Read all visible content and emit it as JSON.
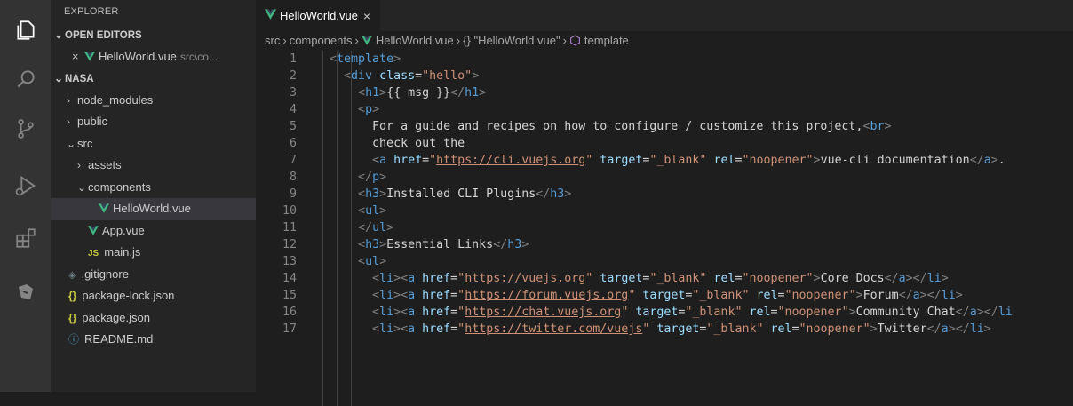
{
  "activity_bar": {
    "icons": [
      "explorer-icon",
      "search-icon",
      "source-control-icon",
      "run-debug-icon",
      "extensions-icon",
      "remote-explorer-icon"
    ]
  },
  "sidebar": {
    "title": "EXPLORER",
    "open_editors": {
      "label": "OPEN EDITORS",
      "items": [
        {
          "name": "HelloWorld.vue",
          "path": "src\\co..."
        }
      ]
    },
    "project": {
      "label": "NASA",
      "tree": [
        {
          "label": "node_modules",
          "kind": "folder",
          "state": "collapsed",
          "depth": 1
        },
        {
          "label": "public",
          "kind": "folder",
          "state": "collapsed",
          "depth": 1
        },
        {
          "label": "src",
          "kind": "folder",
          "state": "expanded",
          "depth": 1
        },
        {
          "label": "assets",
          "kind": "folder",
          "state": "collapsed",
          "depth": 2
        },
        {
          "label": "components",
          "kind": "folder",
          "state": "expanded",
          "depth": 2
        },
        {
          "label": "HelloWorld.vue",
          "kind": "vue",
          "depth": 3,
          "selected": true
        },
        {
          "label": "App.vue",
          "kind": "vue",
          "depth": 2
        },
        {
          "label": "main.js",
          "kind": "js",
          "depth": 2
        },
        {
          "label": ".gitignore",
          "kind": "git",
          "depth": 1
        },
        {
          "label": "package-lock.json",
          "kind": "json",
          "depth": 1
        },
        {
          "label": "package.json",
          "kind": "json",
          "depth": 1
        },
        {
          "label": "README.md",
          "kind": "info",
          "depth": 1
        }
      ]
    }
  },
  "editor": {
    "tab": {
      "label": "HelloWorld.vue",
      "close": "×"
    },
    "breadcrumb": {
      "parts": [
        "src",
        "components",
        "HelloWorld.vue",
        "\"HelloWorld.vue\"",
        "template"
      ],
      "obj_glyph": "{}"
    },
    "lines": [
      {
        "n": "1",
        "indent": 2,
        "tokens": [
          [
            "br",
            "<"
          ],
          [
            "tag",
            "template"
          ],
          [
            "br",
            ">"
          ]
        ]
      },
      {
        "n": "2",
        "indent": 4,
        "tokens": [
          [
            "br",
            "<"
          ],
          [
            "tag",
            "div"
          ],
          [
            "text",
            " "
          ],
          [
            "attr",
            "class"
          ],
          [
            "text",
            "="
          ],
          [
            "str",
            "\"hello\""
          ],
          [
            "br",
            ">"
          ]
        ]
      },
      {
        "n": "3",
        "indent": 6,
        "tokens": [
          [
            "br",
            "<"
          ],
          [
            "tag",
            "h1"
          ],
          [
            "br",
            ">"
          ],
          [
            "text",
            "{{ msg }}"
          ],
          [
            "br",
            "</"
          ],
          [
            "tag",
            "h1"
          ],
          [
            "br",
            ">"
          ]
        ]
      },
      {
        "n": "4",
        "indent": 6,
        "tokens": [
          [
            "br",
            "<"
          ],
          [
            "tag",
            "p"
          ],
          [
            "br",
            ">"
          ]
        ]
      },
      {
        "n": "5",
        "indent": 8,
        "tokens": [
          [
            "text",
            "For a guide and recipes on how to configure / customize this project,"
          ],
          [
            "br",
            "<"
          ],
          [
            "tag",
            "br"
          ],
          [
            "br",
            ">"
          ]
        ]
      },
      {
        "n": "6",
        "indent": 8,
        "tokens": [
          [
            "text",
            "check out the"
          ]
        ]
      },
      {
        "n": "7",
        "indent": 8,
        "tokens": [
          [
            "br",
            "<"
          ],
          [
            "tag",
            "a"
          ],
          [
            "text",
            " "
          ],
          [
            "attr",
            "href"
          ],
          [
            "text",
            "="
          ],
          [
            "str",
            "\""
          ],
          [
            "url",
            "https://cli.vuejs.org"
          ],
          [
            "str",
            "\""
          ],
          [
            "text",
            " "
          ],
          [
            "attr",
            "target"
          ],
          [
            "text",
            "="
          ],
          [
            "str",
            "\"_blank\""
          ],
          [
            "text",
            " "
          ],
          [
            "attr",
            "rel"
          ],
          [
            "text",
            "="
          ],
          [
            "str",
            "\"noopener\""
          ],
          [
            "br",
            ">"
          ],
          [
            "text",
            "vue-cli documentation"
          ],
          [
            "br",
            "</"
          ],
          [
            "tag",
            "a"
          ],
          [
            "br",
            ">"
          ],
          [
            "text",
            "."
          ]
        ]
      },
      {
        "n": "8",
        "indent": 6,
        "tokens": [
          [
            "br",
            "</"
          ],
          [
            "tag",
            "p"
          ],
          [
            "br",
            ">"
          ]
        ]
      },
      {
        "n": "9",
        "indent": 6,
        "tokens": [
          [
            "br",
            "<"
          ],
          [
            "tag",
            "h3"
          ],
          [
            "br",
            ">"
          ],
          [
            "text",
            "Installed CLI Plugins"
          ],
          [
            "br",
            "</"
          ],
          [
            "tag",
            "h3"
          ],
          [
            "br",
            ">"
          ]
        ]
      },
      {
        "n": "10",
        "indent": 6,
        "tokens": [
          [
            "br",
            "<"
          ],
          [
            "tag",
            "ul"
          ],
          [
            "br",
            ">"
          ]
        ]
      },
      {
        "n": "11",
        "indent": 6,
        "tokens": [
          [
            "br",
            "</"
          ],
          [
            "tag",
            "ul"
          ],
          [
            "br",
            ">"
          ]
        ]
      },
      {
        "n": "12",
        "indent": 6,
        "tokens": [
          [
            "br",
            "<"
          ],
          [
            "tag",
            "h3"
          ],
          [
            "br",
            ">"
          ],
          [
            "text",
            "Essential Links"
          ],
          [
            "br",
            "</"
          ],
          [
            "tag",
            "h3"
          ],
          [
            "br",
            ">"
          ]
        ]
      },
      {
        "n": "13",
        "indent": 6,
        "tokens": [
          [
            "br",
            "<"
          ],
          [
            "tag",
            "ul"
          ],
          [
            "br",
            ">"
          ]
        ]
      },
      {
        "n": "14",
        "indent": 8,
        "tokens": [
          [
            "br",
            "<"
          ],
          [
            "tag",
            "li"
          ],
          [
            "br",
            "><"
          ],
          [
            "tag",
            "a"
          ],
          [
            "text",
            " "
          ],
          [
            "attr",
            "href"
          ],
          [
            "text",
            "="
          ],
          [
            "str",
            "\""
          ],
          [
            "url",
            "https://vuejs.org"
          ],
          [
            "str",
            "\""
          ],
          [
            "text",
            " "
          ],
          [
            "attr",
            "target"
          ],
          [
            "text",
            "="
          ],
          [
            "str",
            "\"_blank\""
          ],
          [
            "text",
            " "
          ],
          [
            "attr",
            "rel"
          ],
          [
            "text",
            "="
          ],
          [
            "str",
            "\"noopener\""
          ],
          [
            "br",
            ">"
          ],
          [
            "text",
            "Core Docs"
          ],
          [
            "br",
            "</"
          ],
          [
            "tag",
            "a"
          ],
          [
            "br",
            "></"
          ],
          [
            "tag",
            "li"
          ],
          [
            "br",
            ">"
          ]
        ]
      },
      {
        "n": "15",
        "indent": 8,
        "tokens": [
          [
            "br",
            "<"
          ],
          [
            "tag",
            "li"
          ],
          [
            "br",
            "><"
          ],
          [
            "tag",
            "a"
          ],
          [
            "text",
            " "
          ],
          [
            "attr",
            "href"
          ],
          [
            "text",
            "="
          ],
          [
            "str",
            "\""
          ],
          [
            "url",
            "https://forum.vuejs.org"
          ],
          [
            "str",
            "\""
          ],
          [
            "text",
            " "
          ],
          [
            "attr",
            "target"
          ],
          [
            "text",
            "="
          ],
          [
            "str",
            "\"_blank\""
          ],
          [
            "text",
            " "
          ],
          [
            "attr",
            "rel"
          ],
          [
            "text",
            "="
          ],
          [
            "str",
            "\"noopener\""
          ],
          [
            "br",
            ">"
          ],
          [
            "text",
            "Forum"
          ],
          [
            "br",
            "</"
          ],
          [
            "tag",
            "a"
          ],
          [
            "br",
            "></"
          ],
          [
            "tag",
            "li"
          ],
          [
            "br",
            ">"
          ]
        ]
      },
      {
        "n": "16",
        "indent": 8,
        "tokens": [
          [
            "br",
            "<"
          ],
          [
            "tag",
            "li"
          ],
          [
            "br",
            "><"
          ],
          [
            "tag",
            "a"
          ],
          [
            "text",
            " "
          ],
          [
            "attr",
            "href"
          ],
          [
            "text",
            "="
          ],
          [
            "str",
            "\""
          ],
          [
            "url",
            "https://chat.vuejs.org"
          ],
          [
            "str",
            "\""
          ],
          [
            "text",
            " "
          ],
          [
            "attr",
            "target"
          ],
          [
            "text",
            "="
          ],
          [
            "str",
            "\"_blank\""
          ],
          [
            "text",
            " "
          ],
          [
            "attr",
            "rel"
          ],
          [
            "text",
            "="
          ],
          [
            "str",
            "\"noopener\""
          ],
          [
            "br",
            ">"
          ],
          [
            "text",
            "Community Chat"
          ],
          [
            "br",
            "</"
          ],
          [
            "tag",
            "a"
          ],
          [
            "br",
            "></"
          ],
          [
            "tag",
            "li"
          ]
        ]
      },
      {
        "n": "17",
        "indent": 8,
        "tokens": [
          [
            "br",
            "<"
          ],
          [
            "tag",
            "li"
          ],
          [
            "br",
            "><"
          ],
          [
            "tag",
            "a"
          ],
          [
            "text",
            " "
          ],
          [
            "attr",
            "href"
          ],
          [
            "text",
            "="
          ],
          [
            "str",
            "\""
          ],
          [
            "url",
            "https://twitter.com/vuejs"
          ],
          [
            "str",
            "\""
          ],
          [
            "text",
            " "
          ],
          [
            "attr",
            "target"
          ],
          [
            "text",
            "="
          ],
          [
            "str",
            "\"_blank\""
          ],
          [
            "text",
            " "
          ],
          [
            "attr",
            "rel"
          ],
          [
            "text",
            "="
          ],
          [
            "str",
            "\"noopener\""
          ],
          [
            "br",
            ">"
          ],
          [
            "text",
            "Twitter"
          ],
          [
            "br",
            "</"
          ],
          [
            "tag",
            "a"
          ],
          [
            "br",
            "></"
          ],
          [
            "tag",
            "li"
          ],
          [
            "br",
            ">"
          ]
        ]
      }
    ]
  }
}
